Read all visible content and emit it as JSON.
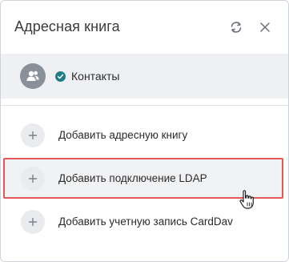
{
  "header": {
    "title": "Адресная книга",
    "icons": {
      "refresh": "refresh-icon",
      "close": "close-icon"
    }
  },
  "account": {
    "label": "Контакты",
    "avatar_icon": "contacts-group-icon",
    "status_icon": "check-circle-icon",
    "status_color": "#1d7f86"
  },
  "actions": [
    {
      "label": "Добавить адресную книгу",
      "icon": "plus-icon"
    },
    {
      "label": "Добавить подключение LDAP",
      "icon": "plus-icon",
      "highlighted": true
    },
    {
      "label": "Добавить учетную запись CardDav",
      "icon": "plus-icon"
    }
  ],
  "colors": {
    "highlight_border": "#e45757",
    "row_background": "#eef0f3"
  }
}
